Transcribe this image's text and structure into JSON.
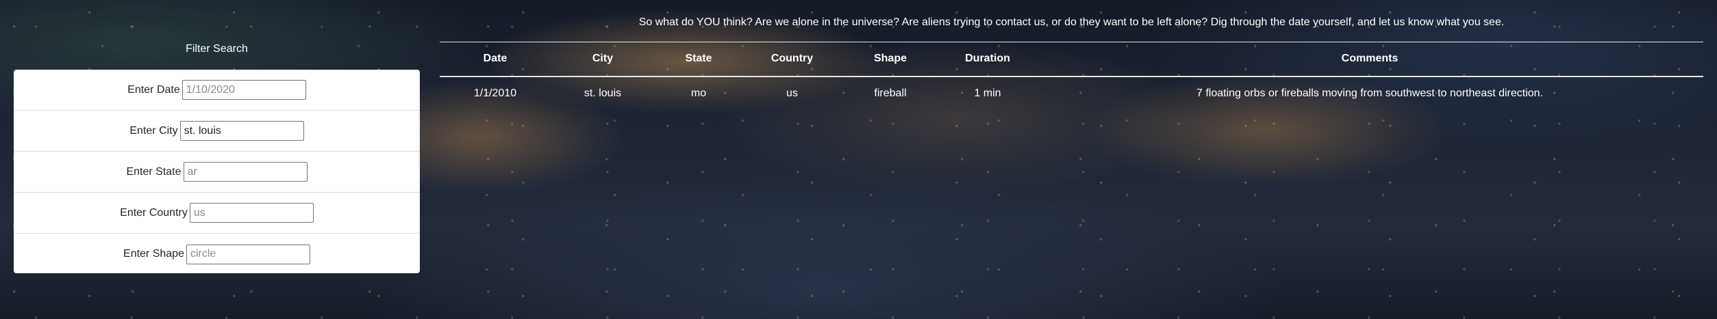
{
  "intro_text": "So what do YOU think? Are we alone in the universe? Are aliens trying to contact us, or do they want to be left alone? Dig through the date yourself, and let us know what you see.",
  "filter": {
    "title": "Filter Search",
    "fields": [
      {
        "label": "Enter Date",
        "placeholder": "1/10/2020",
        "value": ""
      },
      {
        "label": "Enter City",
        "placeholder": "",
        "value": "st. louis"
      },
      {
        "label": "Enter State",
        "placeholder": "ar",
        "value": ""
      },
      {
        "label": "Enter Country",
        "placeholder": "us",
        "value": ""
      },
      {
        "label": "Enter Shape",
        "placeholder": "circle",
        "value": ""
      }
    ]
  },
  "table": {
    "headers": [
      "Date",
      "City",
      "State",
      "Country",
      "Shape",
      "Duration",
      "Comments"
    ],
    "rows": [
      [
        "1/1/2010",
        "st. louis",
        "mo",
        "us",
        "fireball",
        "1 min",
        "7 floating orbs or fireballs moving from southwest to northeast direction."
      ]
    ]
  }
}
